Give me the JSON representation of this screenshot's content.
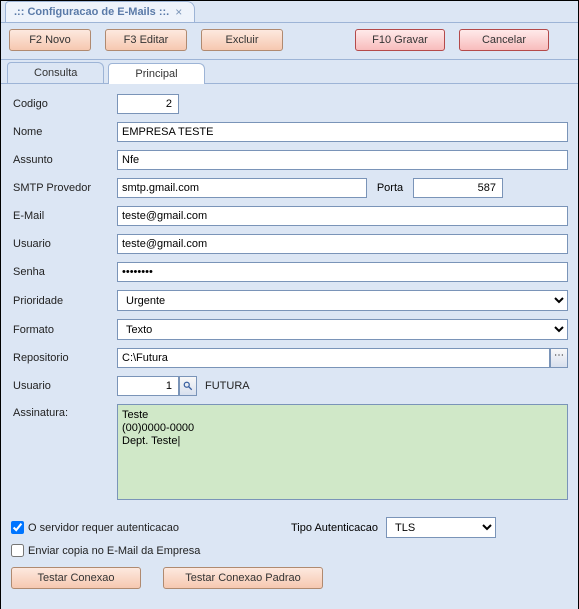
{
  "window": {
    "title": ".:: Configuracao de E-Mails ::."
  },
  "toolbar": {
    "novo": "F2 Novo",
    "editar": "F3 Editar",
    "excluir": "Excluir",
    "gravar": "F10 Gravar",
    "cancelar": "Cancelar"
  },
  "tabs": {
    "consulta": "Consulta",
    "principal": "Principal"
  },
  "labels": {
    "codigo": "Codigo",
    "nome": "Nome",
    "assunto": "Assunto",
    "smtp": "SMTP Provedor",
    "porta": "Porta",
    "email": "E-Mail",
    "usuario": "Usuario",
    "senha": "Senha",
    "prioridade": "Prioridade",
    "formato": "Formato",
    "repositorio": "Repositorio",
    "usuario2": "Usuario",
    "assinatura": "Assinatura:",
    "req_auth": "O servidor requer autenticacao",
    "tipo_auth": "Tipo Autenticacao",
    "copia_empresa": "Enviar copia no E-Mail da Empresa",
    "testar": "Testar Conexao",
    "testar_padrao": "Testar Conexao Padrao"
  },
  "values": {
    "codigo": "2",
    "nome": "EMPRESA TESTE",
    "assunto": "Nfe",
    "smtp": "smtp.gmail.com",
    "porta": "587",
    "email": "teste@gmail.com",
    "usuario": "teste@gmail.com",
    "senha": "••••••••",
    "prioridade": "Urgente",
    "formato": "Texto",
    "repositorio": "C:\\Futura",
    "usuario2_id": "1",
    "usuario2_nome": "FUTURA",
    "assinatura": "Teste\n(00)0000-0000\nDept. Teste|",
    "tipo_auth": "TLS",
    "req_auth_checked": true,
    "copia_empresa_checked": false
  }
}
